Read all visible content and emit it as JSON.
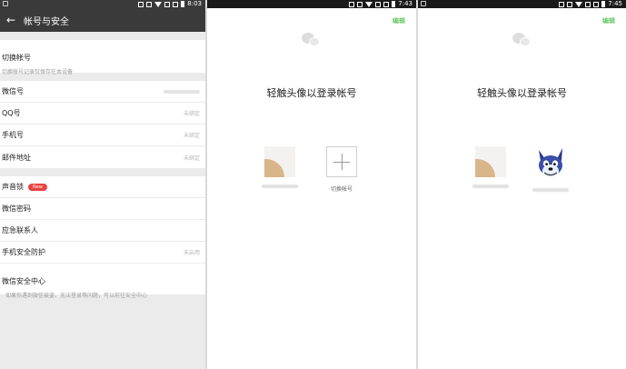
{
  "panel1": {
    "status_time": "8:03",
    "title": "帐号与安全",
    "switch_account": {
      "label": "切换帐号",
      "sub": "切换帐号记录仅保存在本设备"
    },
    "group2": [
      {
        "label": "微信号",
        "value": ""
      },
      {
        "label": "QQ号",
        "value": "未绑定"
      },
      {
        "label": "手机号",
        "value": "未绑定"
      },
      {
        "label": "邮件地址",
        "value": "未绑定"
      }
    ],
    "voice_lock": {
      "label": "声音锁",
      "badge": "New"
    },
    "wechat_password": {
      "label": "微信密码"
    },
    "emergency_contact": {
      "label": "应急联系人"
    },
    "phone_protection": {
      "label": "手机安全防护",
      "value": "未启用"
    },
    "security_center": {
      "label": "微信安全中心",
      "sub": "如果你遇到微信被盗、无法登录等问题，可以前往安全中心"
    }
  },
  "panel2": {
    "status_time": "7:43",
    "edit_label": "编辑",
    "heading": "轻触头像以登录帐号",
    "add_account_label": "切换帐号"
  },
  "panel3": {
    "status_time": "7:45",
    "edit_label": "编辑",
    "heading": "轻触头像以登录帐号"
  },
  "colors": {
    "accent_green": "#1aad19",
    "badge_red": "#e64340",
    "titlebar": "#3a3a3a"
  }
}
